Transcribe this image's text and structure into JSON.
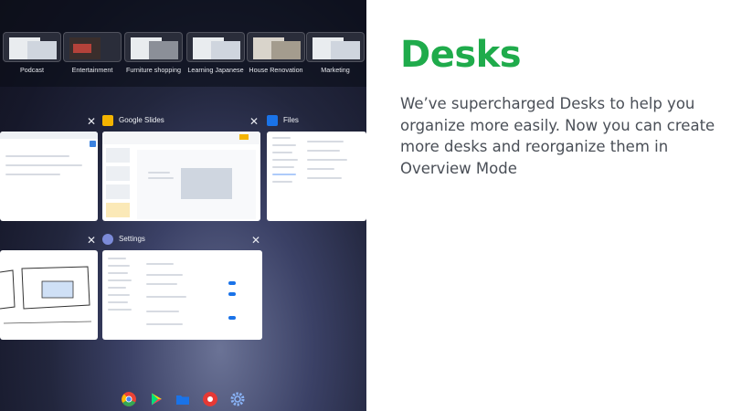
{
  "overview": {
    "desks": [
      {
        "label": "Podcast"
      },
      {
        "label": "Entertainment"
      },
      {
        "label": "Furniture shopping"
      },
      {
        "label": "Learning Japanese"
      },
      {
        "label": "House Renovation"
      },
      {
        "label": "Marketing"
      }
    ],
    "windows": {
      "slides_title": "Google Slides",
      "files_title": "Files",
      "settings_title": "Settings",
      "close_glyph": "✕"
    }
  },
  "shelf": {
    "apps": [
      "chrome-icon",
      "play-store-icon",
      "files-icon",
      "photo-app-icon",
      "settings-icon"
    ]
  },
  "panel": {
    "title": "Desks",
    "description": "We’ve supercharged Desks to help you organize more easily. Now you can create more desks and reorganize them in Overview Mode"
  },
  "colors": {
    "title_green": "#1fab4b",
    "body_text": "#4a4f57"
  }
}
